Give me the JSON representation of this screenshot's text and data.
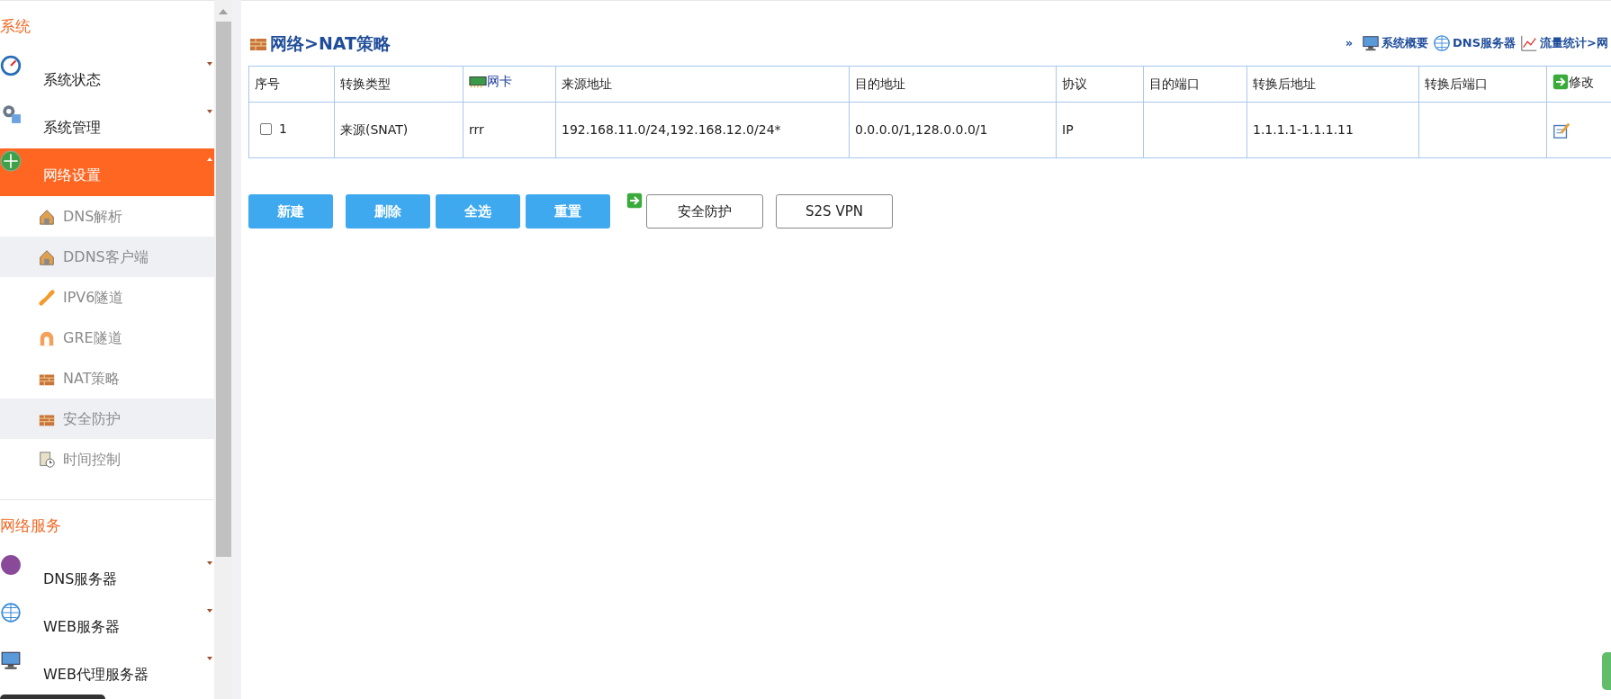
{
  "sidebar": {
    "sections": [
      {
        "title": "系统",
        "items": [
          {
            "label": "系统状态",
            "selected": false
          },
          {
            "label": "系统管理",
            "selected": false
          },
          {
            "label": "网络设置",
            "selected": true,
            "children": [
              {
                "label": "DNS解析",
                "hovered": false
              },
              {
                "label": "DDNS客户端",
                "hovered": true
              },
              {
                "label": "IPV6隧道",
                "hovered": false
              },
              {
                "label": "GRE隧道",
                "hovered": false
              },
              {
                "label": "NAT策略",
                "hovered": false
              },
              {
                "label": "安全防护",
                "hovered": true
              },
              {
                "label": "时间控制",
                "hovered": false
              }
            ]
          }
        ]
      },
      {
        "title": "网络服务",
        "items": [
          {
            "label": "DNS服务器",
            "selected": false
          },
          {
            "label": "WEB服务器",
            "selected": false
          },
          {
            "label": "WEB代理服务器",
            "selected": false
          }
        ]
      }
    ]
  },
  "page_title": "网络>NAT策略",
  "quick_links": {
    "prefix": "»",
    "links": [
      {
        "label": "系统概要"
      },
      {
        "label": "DNS服务器"
      },
      {
        "label": "流量统计>网"
      }
    ]
  },
  "table": {
    "columns": [
      {
        "label": "序号",
        "kind": "text"
      },
      {
        "label": "转换类型",
        "kind": "text"
      },
      {
        "label": "网卡",
        "kind": "link"
      },
      {
        "label": "来源地址",
        "kind": "text"
      },
      {
        "label": "目的地址",
        "kind": "text"
      },
      {
        "label": "协议",
        "kind": "text"
      },
      {
        "label": "目的端口",
        "kind": "text"
      },
      {
        "label": "转换后地址",
        "kind": "text"
      },
      {
        "label": "转换后端口",
        "kind": "text"
      },
      {
        "label": "修改",
        "kind": "action"
      }
    ],
    "rows": [
      {
        "checked": false,
        "cells": [
          "1",
          "来源(SNAT)",
          "rrr",
          "192.168.11.0/24,192.168.12.0/24*",
          "0.0.0.0/1,128.0.0.0/1",
          "IP",
          "",
          "1.1.1.1-1.1.1.11",
          ""
        ]
      }
    ]
  },
  "buttons": [
    {
      "label": "新建",
      "kind": "primary"
    },
    {
      "label": "删除",
      "kind": "primary"
    },
    {
      "label": "全选",
      "kind": "primary"
    },
    {
      "label": "重置",
      "kind": "primary"
    },
    {
      "label": "安全防护",
      "kind": "outline"
    },
    {
      "label": "S2S VPN",
      "kind": "outline"
    }
  ]
}
